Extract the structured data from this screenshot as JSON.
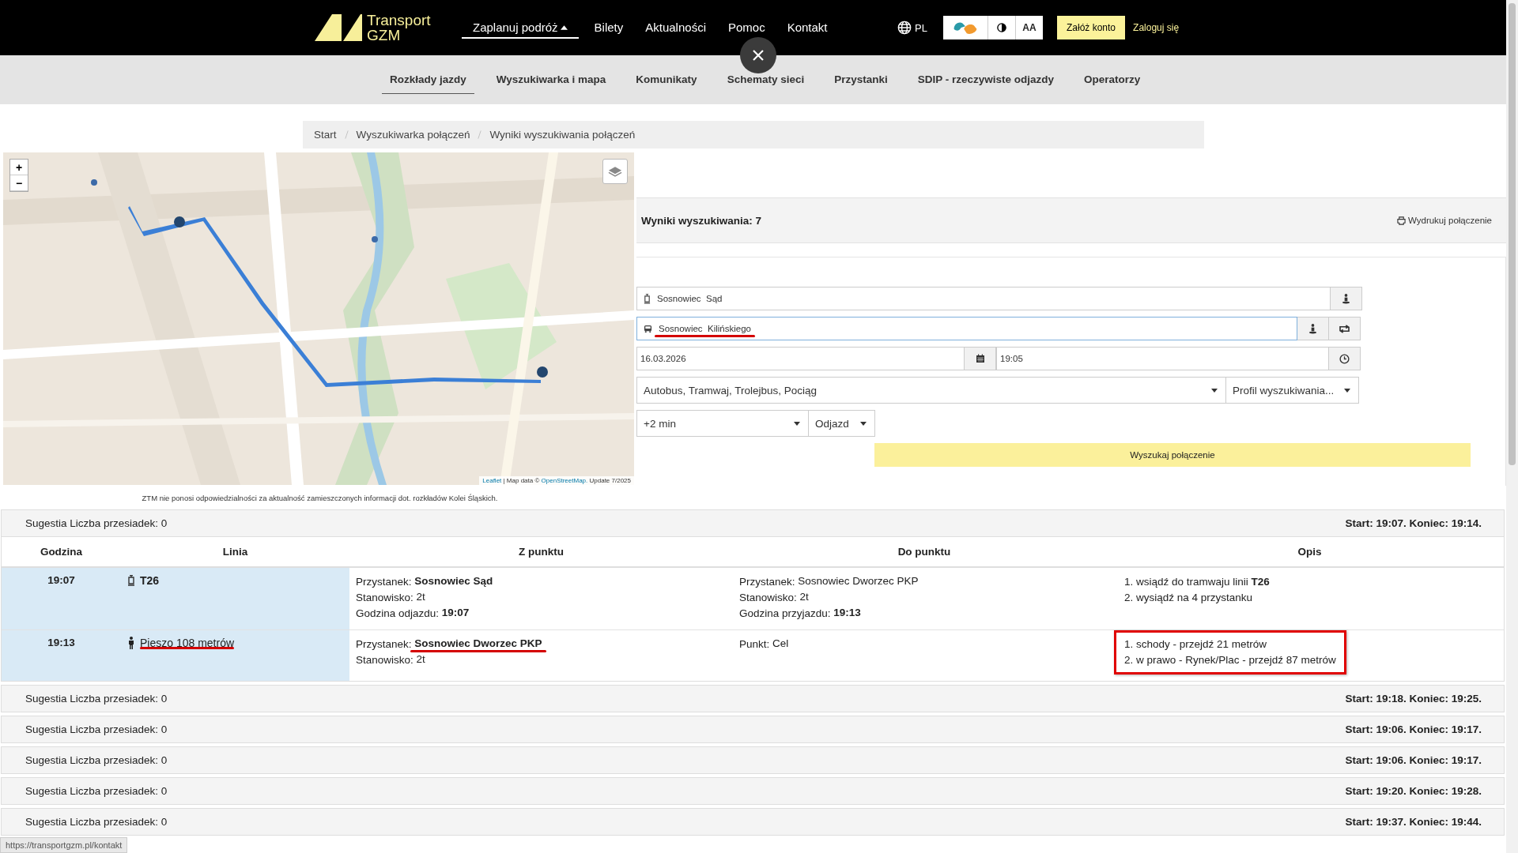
{
  "header": {
    "logo": {
      "line1": "Transport",
      "line2": "GZM"
    },
    "nav": [
      {
        "label": "Zaplanuj podróż",
        "selected": true,
        "expanded": true
      },
      {
        "label": "Bilety",
        "selected": false,
        "expanded": false
      },
      {
        "label": "Aktualności",
        "selected": false,
        "expanded": false
      },
      {
        "label": "Pomoc",
        "selected": false,
        "expanded": false
      },
      {
        "label": "Kontakt",
        "selected": false,
        "expanded": false
      }
    ],
    "language": "PL",
    "font_size_toggle": "AA",
    "register": "Załóż konto",
    "login": "Zaloguj się"
  },
  "subnav": [
    {
      "label": "Rozkłady jazdy",
      "selected": true
    },
    {
      "label": "Wyszukiwarka i mapa",
      "selected": false
    },
    {
      "label": "Komunikaty",
      "selected": false
    },
    {
      "label": "Schematy sieci",
      "selected": false
    },
    {
      "label": "Przystanki",
      "selected": false
    },
    {
      "label": "SDIP - rzeczywiste odjazdy",
      "selected": false
    },
    {
      "label": "Operatorzy",
      "selected": false
    }
  ],
  "breadcrumb": [
    "Start",
    "Wyszukiwarka połączeń",
    "Wyniki wyszukiwania połączeń"
  ],
  "map": {
    "zoom_in": "+",
    "zoom_out": "−",
    "attribution_lib": "Leaflet",
    "attribution_text": "| Map data ©",
    "attribution_link": "OpenStreetMap.",
    "attribution_update": "Update 7/2025",
    "disclaimer": "ZTM nie ponosi odpowiedzialności za aktualność zamieszczonych informacji dot. rozkładów Kolei Śląskich."
  },
  "results": {
    "title": "Wyniki wyszukiwania: 7",
    "print": "Wydrukuj połączenie"
  },
  "form": {
    "from": {
      "value": "Sosnowiec  Sąd",
      "kind": "tram",
      "focused": false,
      "underlined": false
    },
    "to": {
      "value": "Sosnowiec  Kilińskiego",
      "kind": "bus",
      "focused": true,
      "underlined": true
    },
    "date": "16.03.2026",
    "time": "19:05",
    "modes": "Autobus, Tramwaj, Trolejbus, Pociąg",
    "profile": "Profil wyszukiwania...",
    "offset": "+2 min",
    "direction": "Odjazd",
    "search": "Wyszukaj połączenie"
  },
  "connections": [
    {
      "summary": "Sugestia Liczba przesiadek: 0",
      "times": "Start: 19:07. Koniec: 19:14.",
      "columns": [
        "Godzina",
        "Linia",
        "Z punktu",
        "Do punktu",
        "Opis"
      ],
      "legs": [
        {
          "time": "19:07",
          "kind": "tram",
          "line": "T26",
          "underlined": false,
          "from": [
            {
              "label": "Przystanek:",
              "value": "Sosnowiec Sąd",
              "bold": true,
              "underlined": false
            },
            {
              "label": "Stanowisko:",
              "value": "2t",
              "bold": false,
              "underlined": false
            },
            {
              "label": "Godzina odjazdu:",
              "value": "19:07",
              "bold": true,
              "underlined": false
            }
          ],
          "to": [
            {
              "label": "Przystanek:",
              "value": "Sosnowiec Dworzec PKP",
              "bold": false,
              "underlined": false
            },
            {
              "label": "Stanowisko:",
              "value": "2t",
              "bold": false,
              "underlined": false
            },
            {
              "label": "Godzina przyjazdu:",
              "value": "19:13",
              "bold": true,
              "underlined": false
            }
          ],
          "description": [
            "1. wsiądź do tramwaju linii **T26**",
            "2. wysiądź na 4 przystanku"
          ],
          "highlighted": false
        },
        {
          "time": "19:13",
          "kind": "walk",
          "line": "Pieszo 108 metrów",
          "underlined": true,
          "from": [
            {
              "label": "Przystanek:",
              "value": "Sosnowiec Dworzec PKP",
              "bold": true,
              "underlined": true
            },
            {
              "label": "Stanowisko:",
              "value": "2t",
              "bold": false,
              "underlined": false
            }
          ],
          "to": [
            {
              "label": "Punkt:",
              "value": "Cel",
              "bold": false,
              "underlined": false
            }
          ],
          "description": [
            "1. schody - przejdź 21 metrów",
            "2. w prawo - Rynek/Plac - przejdź 87 metrów"
          ],
          "highlighted": true
        }
      ]
    },
    {
      "summary": "Sugestia Liczba przesiadek: 0",
      "times": "Start: 19:18. Koniec: 19:25."
    },
    {
      "summary": "Sugestia Liczba przesiadek: 0",
      "times": "Start: 19:06. Koniec: 19:17."
    },
    {
      "summary": "Sugestia Liczba przesiadek: 0",
      "times": "Start: 19:06. Koniec: 19:17."
    },
    {
      "summary": "Sugestia Liczba przesiadek: 0",
      "times": "Start: 19:20. Koniec: 19:28."
    },
    {
      "summary": "Sugestia Liczba przesiadek: 0",
      "times": "Start: 19:37. Koniec: 19:44."
    }
  ],
  "status_bar": "https://transportgzm.pl/kontakt"
}
